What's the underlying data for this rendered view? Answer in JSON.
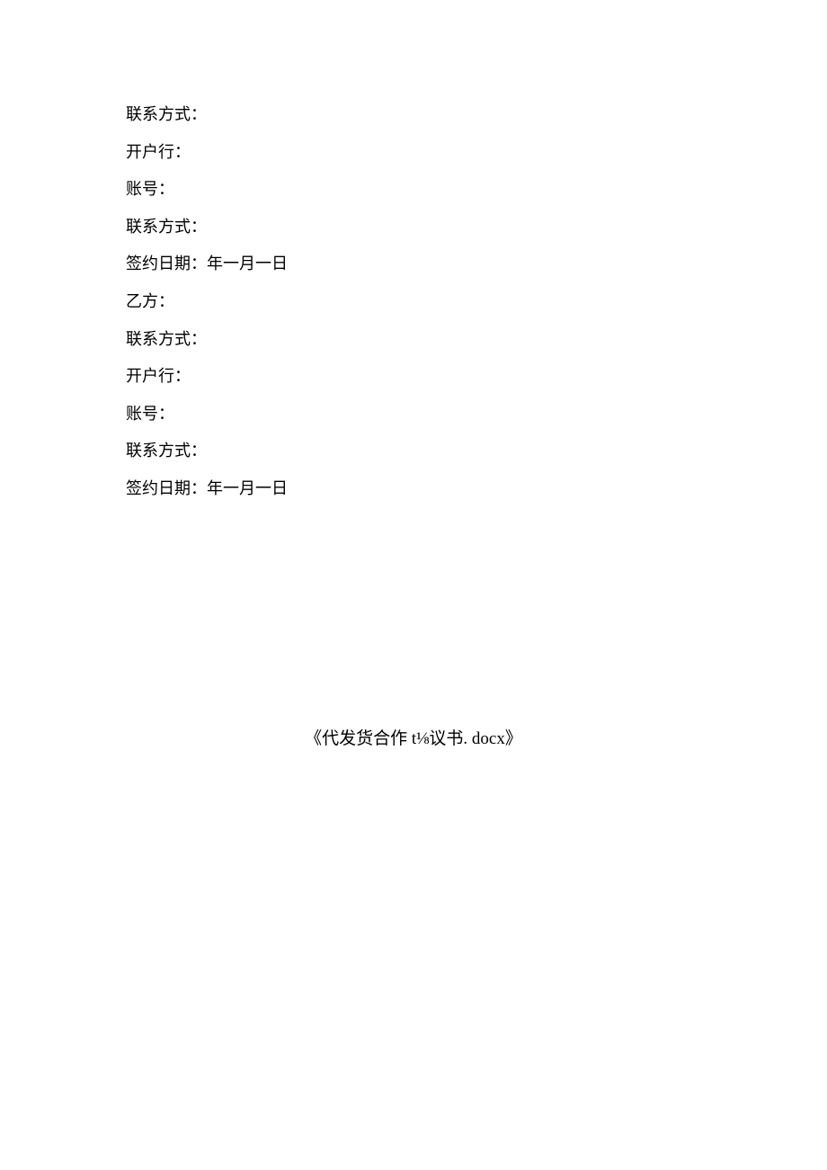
{
  "fields": {
    "contact1": "联系方式：",
    "bank1": "开户行：",
    "account1": "账号：",
    "contact1b": "联系方式：",
    "signdate1": "签约日期：年一月一日",
    "partyB": "乙方：",
    "contact2": "联系方式：",
    "bank2": "开户行：",
    "account2": "账号：",
    "contact2b": "联系方式：",
    "signdate2": "签约日期：年一月一日"
  },
  "footer": {
    "title": "《代发货合作 t⅛议书. docx》"
  }
}
